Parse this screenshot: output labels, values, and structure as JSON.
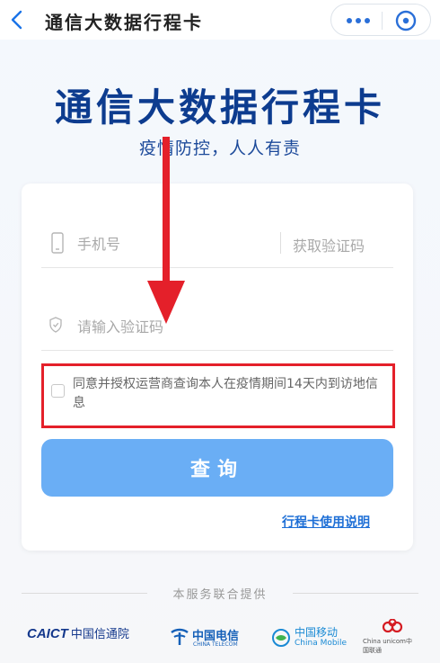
{
  "nav": {
    "title": "通信大数据行程卡",
    "back_icon": "chevron-left-icon",
    "more_icon": "more-dots-icon",
    "close_icon": "close-circle-icon"
  },
  "hero": {
    "title": "通信大数据行程卡",
    "subtitle": "疫情防控，人人有责"
  },
  "form": {
    "phone_placeholder": "手机号",
    "get_code_label": "获取验证码",
    "code_placeholder": "请输入验证码",
    "agreement_text": "同意并授权运营商查询本人在疫情期间14天内到访地信息",
    "agreement_checked": false,
    "query_button": "查询",
    "guide_link": "行程卡使用说明"
  },
  "footer": {
    "provided_by": "本服务联合提供",
    "logos": [
      {
        "name": "caict",
        "en": "CAICT",
        "cn": "中国信通院"
      },
      {
        "name": "china-telecom",
        "cn": "中国电信",
        "en": "CHINA TELECOM"
      },
      {
        "name": "china-mobile",
        "cn": "中国移动",
        "en": "China Mobile"
      },
      {
        "name": "china-unicom",
        "en": "China unicom中国联通"
      }
    ]
  },
  "colors": {
    "brand_blue": "#0d3c8f",
    "button_blue": "#6aaef5",
    "link_blue": "#1e6fd6",
    "highlight_red": "#e4202a"
  }
}
